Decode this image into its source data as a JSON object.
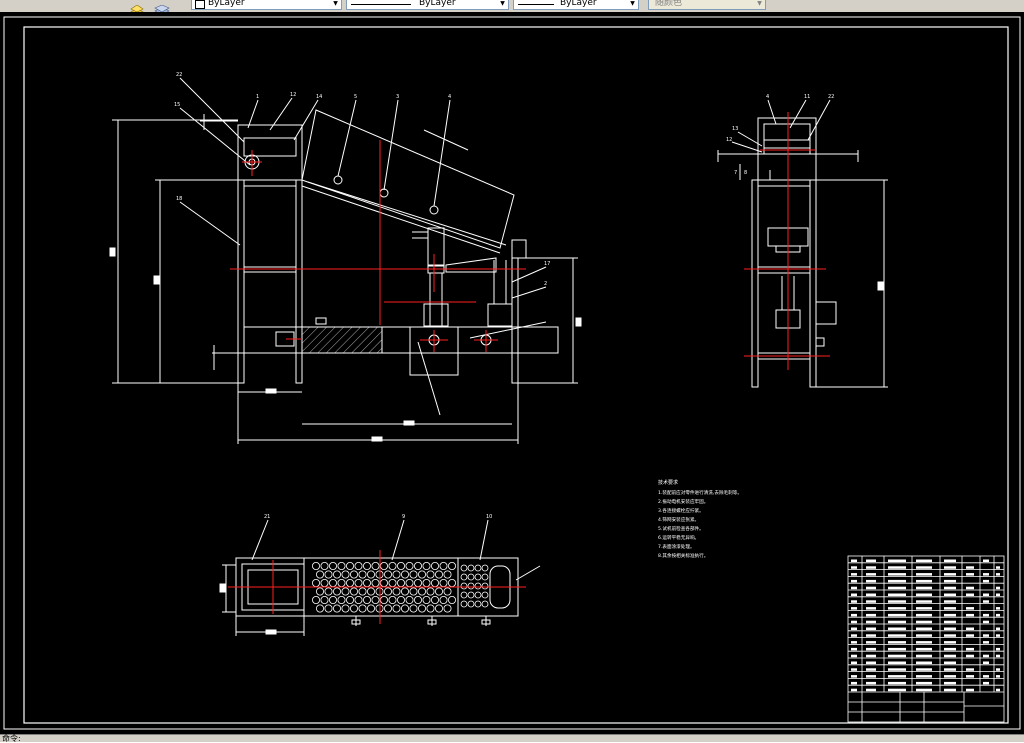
{
  "toolbar": {
    "layer_icons": [
      "layers-manager-icon",
      "layer-states-icon"
    ],
    "color_control": {
      "value": "ByLayer"
    },
    "linetype_control": {
      "value": "ByLayer"
    },
    "lineweight_control": {
      "value": "ByLayer"
    },
    "plotstyle_control": {
      "value": "随颜色"
    }
  },
  "drawing": {
    "part_callouts_front": [
      "22",
      "15",
      "1",
      "12",
      "14",
      "5",
      "3",
      "4",
      "18",
      "17",
      "2"
    ],
    "part_callouts_side": [
      "4",
      "11",
      "22",
      "13",
      "12",
      "7",
      "8"
    ],
    "part_callouts_plan": [
      "21",
      "9",
      "10"
    ],
    "notes_title": "技术要求",
    "notes": [
      "1.装配前应对零件进行清洗,去除毛刺等。",
      "2.振动电机安装应牢固。",
      "3.各连接螺栓应拧紧。",
      "4.筛网安装应张紧。",
      "5.试机前检查各部件。",
      "6.运转平稳无异响。",
      "7.表面涂漆处理。",
      "8.其余按相关标准执行。"
    ]
  },
  "title_block": {
    "rows": 20
  },
  "statusbar": {
    "text": "命令:"
  }
}
